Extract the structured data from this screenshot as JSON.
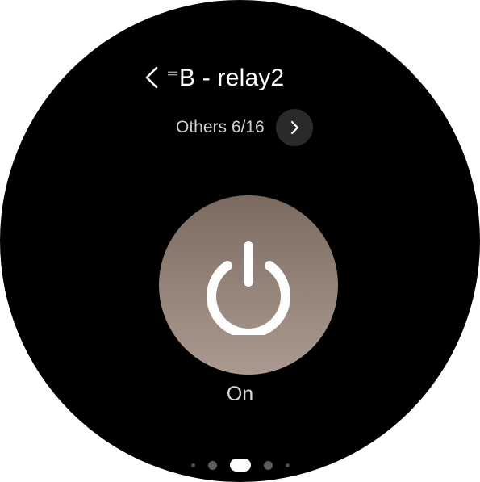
{
  "header": {
    "title_prefix": "⺀",
    "title_fade": "⺀",
    "title": "B - relay2"
  },
  "category": {
    "label": "Others 6/16"
  },
  "device": {
    "state_label": "On",
    "power_button_color": "#96857b"
  },
  "pager": {
    "total": 5,
    "active_index": 2
  },
  "icons": {
    "back": "chevron-left-icon",
    "next": "chevron-right-icon",
    "power": "power-icon"
  }
}
